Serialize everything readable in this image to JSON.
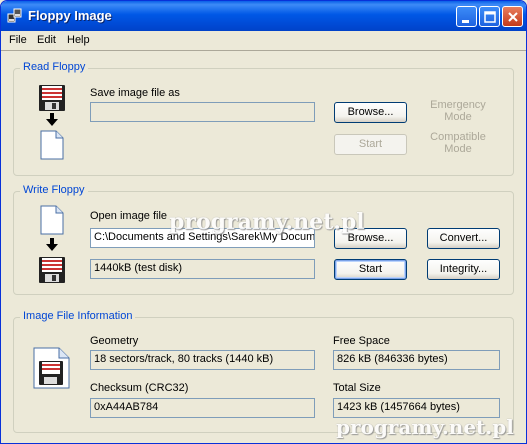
{
  "window": {
    "title": "Floppy Image"
  },
  "menu": [
    {
      "label": "File"
    },
    {
      "label": "Edit"
    },
    {
      "label": "Help"
    }
  ],
  "read_floppy": {
    "group_label": "Read Floppy",
    "save_label": "Save image file as",
    "save_value": "",
    "browse_label": "Browse...",
    "start_label": "Start",
    "emergency_mode": "Emergency\nMode",
    "compatible_mode": "Compatible\nMode"
  },
  "write_floppy": {
    "group_label": "Write Floppy",
    "open_label": "Open image file",
    "open_value": "C:\\Documents and Settings\\Sarek\\My Docum",
    "browse_label": "Browse...",
    "convert_label": "Convert...",
    "disk_value": "1440kB (test disk)",
    "start_label": "Start",
    "integrity_label": "Integrity..."
  },
  "image_info": {
    "group_label": "Image File Information",
    "geometry_label": "Geometry",
    "geometry_value": "18 sectors/track, 80 tracks (1440 kB)",
    "free_space_label": "Free Space",
    "free_space_value": "826 kB (846336 bytes)",
    "checksum_label": "Checksum (CRC32)",
    "checksum_value": "0xA44AB784",
    "total_size_label": "Total Size",
    "total_size_value": "1423 kB (1457664 bytes)"
  },
  "watermark": {
    "text": "programy.net.pl"
  },
  "colors": {
    "title_bar": "#0058e6",
    "group_label": "#0046d5",
    "field_border": "#7f9db9"
  }
}
